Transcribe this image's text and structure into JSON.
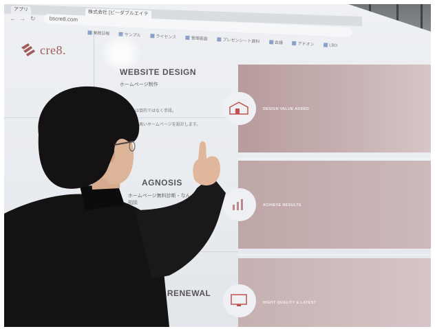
{
  "browser": {
    "tab_label": "株式会社 [ビーダブルエイテ",
    "url": "bscre8.com",
    "bookmarks": [
      "業務日報",
      "サンプル",
      "ライセンス",
      "管理画面",
      "プレゼンシート資料",
      "会議",
      "アドオン",
      "LBO"
    ]
  },
  "site": {
    "logo_text": "cre8.",
    "sections": [
      {
        "title": "WEBSITE DESIGN",
        "subtitle": "ホームページ制作",
        "body_lines": [
          "…のは目的ではなく手段。",
          "…質の高いホームページを設計します。"
        ]
      },
      {
        "title": "AGNOSIS",
        "subtitle": "ホームページ無料診断・なん",
        "body_lines": [
          "相談"
        ]
      },
      {
        "title": "LY RENEWAL",
        "subtitle": "",
        "body_lines": [
          "ル"
        ]
      }
    ],
    "panels": [
      {
        "label": "DESIGN VALUE ADDED"
      },
      {
        "label": "ACHIEVE RESULTS"
      },
      {
        "label": "HIGHT QUALITY & LATEST"
      }
    ]
  },
  "colors": {
    "logo": "#a05a58",
    "panel": "#c2a9aa",
    "jacket": "#141314"
  }
}
